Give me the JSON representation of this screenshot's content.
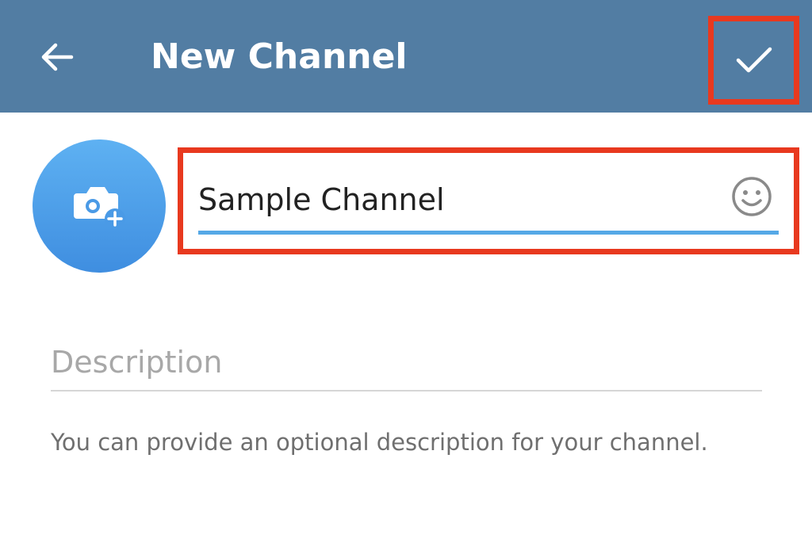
{
  "app_bar": {
    "title": "New Channel",
    "back_icon": "arrow-left-icon",
    "confirm_icon": "checkmark-icon",
    "color": "#527da3"
  },
  "avatar": {
    "icon": "camera-add-icon",
    "color": "#4a9ae6"
  },
  "channel_name": {
    "value": "Sample Channel",
    "emoji_icon": "smiley-icon",
    "accent": "#55a8e6"
  },
  "description": {
    "placeholder": "Description",
    "value": "",
    "hint": "You can provide an optional description for your channel."
  },
  "highlight_color": "#e8391f"
}
